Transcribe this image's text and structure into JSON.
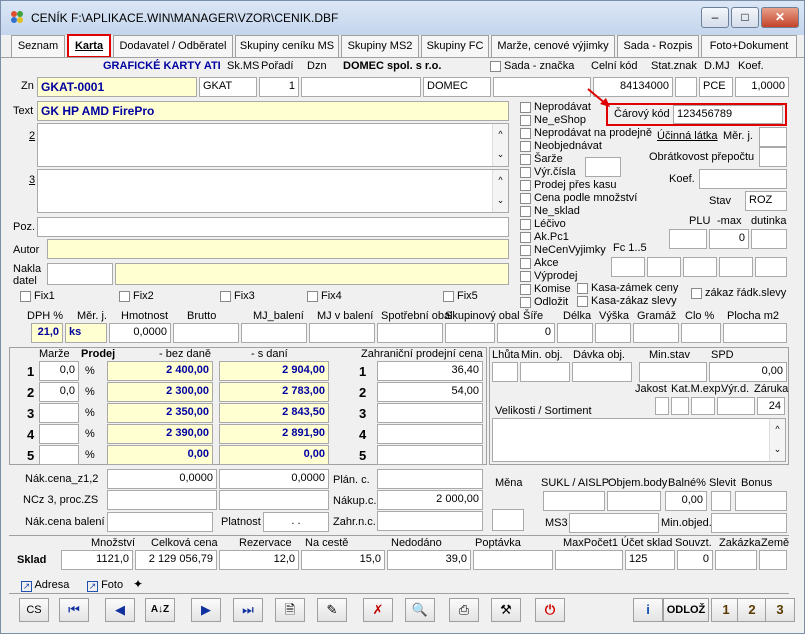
{
  "title": "CENÍK F:\\APLIKACE.WIN\\MANAGER\\VZOR\\CENIK.DBF",
  "tabs": [
    "Seznam",
    "Karta",
    "Dodavatel / Odběratel",
    "Skupiny ceníku MS",
    "Skupiny MS2",
    "Skupiny FC",
    "Marže, cenové výjimky",
    "Sada - Rozpis",
    "Foto+Dokument"
  ],
  "head": {
    "group_title": "GRAFICKÉ KARTY ATI",
    "skms_l": "Sk.MS",
    "poradi_l": "Pořadí",
    "dzn_l": "Dzn",
    "company": "DOMEC spol. s r.o.",
    "sada_l": "Sada - značka",
    "celni_l": "Celní kód",
    "statznak_l": "Stat.znak",
    "dmj_l": "D.MJ",
    "koef_l": "Koef.",
    "zn_l": "Zn",
    "zn": "GKAT-0001",
    "skms": "GKAT",
    "poradi": "1",
    "company_short": "DOMEC",
    "celni": "84134000",
    "dmj": "PCE",
    "koef": "1,0000"
  },
  "text": {
    "text_l": "Text",
    "text": "GK HP AMD FirePro",
    "l2": "2",
    "l3": "3",
    "poz_l": "Poz.",
    "autor_l": "Autor",
    "nakla_l1": "Nakla",
    "nakla_l2": "datel"
  },
  "fix": [
    "Fix1",
    "Fix2",
    "Fix3",
    "Fix4",
    "Fix5"
  ],
  "flags": [
    "Neprodávat",
    "Ne_eShop",
    "Neprodávat na prodejně",
    "Neobjednávat",
    "Šarže",
    "Výr.čísla",
    "Prodej přes kasu",
    "Cena podle množství",
    "Ne_sklad",
    "Léčivo",
    "Ak.Pc1",
    "NeCenVyjimky",
    "Akce",
    "Výprodej",
    "Komise",
    "Odložit"
  ],
  "flags2": [
    "Kasa-zámek ceny",
    "Kasa-zákaz slevy",
    "zákaz řádk.slevy"
  ],
  "barcode": {
    "label": "Čárový kód",
    "value": "123456789"
  },
  "right": {
    "ucinna": "Účinná látka",
    "merj": "Měr. j.",
    "obrat": "Obrátkovost přepočtu",
    "koef": "Koef.",
    "stav": "Stav",
    "stav_v": "ROZ",
    "plu": "PLU",
    "max": "-max",
    "dutinka": "dutinka",
    "max_v": "0",
    "fc": "Fc 1..5"
  },
  "dims": {
    "headers": [
      "DPH %",
      "Měr. j.",
      "Hmotnost",
      "Brutto",
      "MJ_balení",
      "MJ v balení",
      "Spotřební obal",
      "Skupinový obal",
      "Šíře",
      "Délka",
      "Výška",
      "Gramáž",
      "Clo %",
      "Plocha m2"
    ],
    "dph": "21,0",
    "merj": "ks",
    "hmotnost": "0,0000",
    "skup": "0"
  },
  "prices": {
    "marze_l": "Marže",
    "prodej_l": "Prodej",
    "bez_l": "- bez daně",
    "s_l": "- s daní",
    "rows": [
      {
        "n": "1",
        "marze": "0,0",
        "bez": "2 400,00",
        "s": "2 904,00"
      },
      {
        "n": "2",
        "marze": "0,0",
        "bez": "2 300,00",
        "s": "2 783,00"
      },
      {
        "n": "3",
        "marze": "",
        "bez": "2 350,00",
        "s": "2 843,50"
      },
      {
        "n": "4",
        "marze": "",
        "bez": "2 390,00",
        "s": "2 891,90"
      },
      {
        "n": "5",
        "marze": "",
        "bez": "0,00",
        "s": "0,00"
      }
    ],
    "pct": "%"
  },
  "foreign": {
    "label": "Zahraniční prodejní cena",
    "rows": [
      "36,40",
      "54,00",
      "",
      "",
      ""
    ]
  },
  "orders": {
    "lhuta": "Lhůta",
    "minobj": "Min. obj.",
    "davka": "Dávka obj.",
    "minstav": "Min.stav",
    "spd": "SPD",
    "spd_v": "0,00",
    "jakost": "Jakost",
    "katm": "Kat.M.exp.",
    "vyrd": "Výr.d.",
    "zaruka": "Záruka",
    "zaruka_v": "24",
    "velikost": "Velikosti / Sortiment"
  },
  "bottom": {
    "nak_l": "Nák.cena_z1,2",
    "nak1": "0,0000",
    "nak2": "0,0000",
    "ncz_l": "NCz 3, proc.ZS",
    "nakbal_l": "Nák.cena balení",
    "platnost_l": "Platnost",
    "platnost": ". .",
    "plan_l": "Plán. c.",
    "nakupc_l": "Nákup.c.",
    "nakupc": "2 000,00",
    "zahr_l": "Zahr.n.c.",
    "mena_l": "Měna",
    "sukl_l": "SUKL / AISLP",
    "objem_l": "Objem.body",
    "balne_l": "Balné%",
    "slevit_l": "Slevit",
    "bonus_l": "Bonus",
    "balne": "0,00",
    "ms3_l": "MS3",
    "minobjed_l": "Min.objed."
  },
  "sklad": {
    "label": "Sklad",
    "headers": [
      "Množství",
      "Celková cena",
      "Rezervace",
      "Na cestě",
      "Nedodáno",
      "Poptávka",
      "MaxPočet1",
      "Účet sklad",
      "Souvzt.",
      "Zakázka",
      "Země"
    ],
    "mnozstvi": "1121,0",
    "celkova": "2 129 056,79",
    "rezervace": "12,0",
    "nacest": "15,0",
    "nedodano": "39,0",
    "ucet": "125",
    "souvzt": "0"
  },
  "links": {
    "adresa": "Adresa",
    "foto": "Foto"
  },
  "toolbar": {
    "cs": "CS",
    "odloz": "ODLOŽ"
  }
}
